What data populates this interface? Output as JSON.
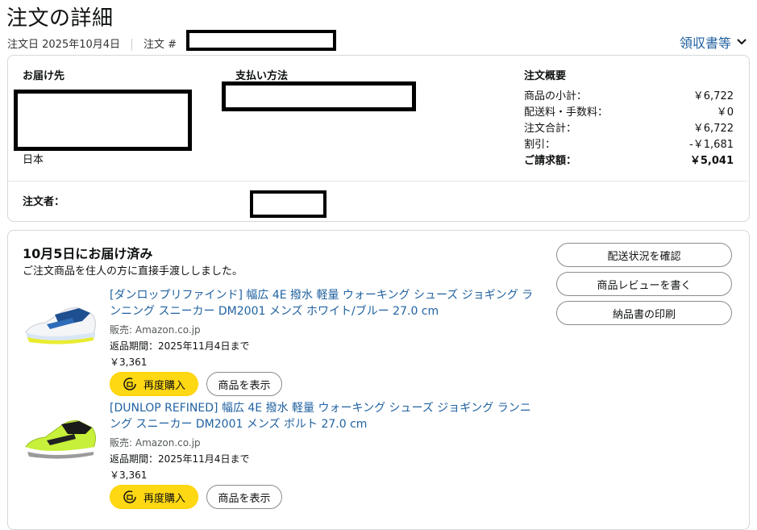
{
  "page": {
    "title": "注文の詳細",
    "order_date": "注文日 2025年10月4日",
    "order_number_label": "注文 #",
    "invoice_link": "領収書等"
  },
  "shipping": {
    "label": "お届け先",
    "country": "日本"
  },
  "payment": {
    "label": "支払い方法"
  },
  "summary": {
    "label": "注文概要",
    "rows": [
      {
        "label": "商品の小計：",
        "value": "￥6,722"
      },
      {
        "label": "配送料・手数料：",
        "value": "￥0"
      },
      {
        "label": "注文合計：",
        "value": "￥6,722"
      },
      {
        "label": "割引：",
        "value": "-￥1,681"
      },
      {
        "label": "ご請求額：",
        "value": "￥5,041"
      }
    ]
  },
  "orderer": {
    "label": "注文者："
  },
  "shipment": {
    "status": "10月5日にお届け済み",
    "detail": "ご注文商品を住人の方に直接手渡ししました。",
    "buttons": [
      "配送状況を確認",
      "商品レビューを書く",
      "納品書の印刷"
    ]
  },
  "items": [
    {
      "title": "[ダンロップリファインド] 幅広 4E 撥水 軽量 ウォーキング シューズ ジョギング ランニング スニーカー DM2001 メンズ ホワイト/ブルー 27.0 cm",
      "seller": "販売: Amazon.co.jp",
      "return": "返品期間：2025年11月4日まで",
      "price": "￥3,361",
      "buy_again": "再度購入",
      "view": "商品を表示"
    },
    {
      "title": "[DUNLOP REFINED] 幅広 4E 撥水 軽量 ウォーキング シューズ ジョギング ランニング スニーカー DM2001 メンズ ボルト 27.0 cm",
      "seller": "販売: Amazon.co.jp",
      "return": "返品期間：2025年11月4日まで",
      "price": "￥3,361",
      "buy_again": "再度購入",
      "view": "商品を表示"
    }
  ],
  "colors": {
    "link": "#2162a1",
    "buy_again": "#ffd814",
    "border": "#d5d9d9"
  }
}
